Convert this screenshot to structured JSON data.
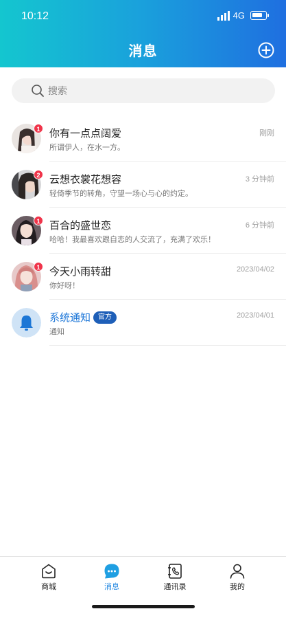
{
  "status_bar": {
    "time": "10:12",
    "network": "4G"
  },
  "header": {
    "title": "消息"
  },
  "search": {
    "placeholder": "搜索"
  },
  "conversations": [
    {
      "name": "你有一点点阔爱",
      "preview": "所谓伊人，在水一方。",
      "time": "刚刚",
      "unread": "1"
    },
    {
      "name": "云想衣裳花想容",
      "preview": "轻倚季节的转角，守望一场心与心的约定。",
      "time": "3 分钟前",
      "unread": "2"
    },
    {
      "name": "百合的盛世恋",
      "preview": "哈哈！我最喜欢跟自恋的人交流了，充满了欢乐！",
      "time": "6 分钟前",
      "unread": "1"
    },
    {
      "name": "今天小雨转甜",
      "preview": "你好呀！",
      "time": "2023/04/02",
      "unread": "1"
    },
    {
      "name": "系统通知",
      "tag": "官方",
      "preview": "通知",
      "time": "2023/04/01"
    }
  ],
  "tabbar": {
    "tabs": [
      {
        "label": "商城",
        "icon": "shop-icon"
      },
      {
        "label": "消息",
        "icon": "message-icon",
        "active": true
      },
      {
        "label": "通讯录",
        "icon": "contacts-icon"
      },
      {
        "label": "我的",
        "icon": "profile-icon"
      }
    ]
  },
  "colors": {
    "header_start": "#14c6cf",
    "header_end": "#1f6fe0",
    "badge": "#f0344a",
    "accent": "#1f86e0"
  }
}
